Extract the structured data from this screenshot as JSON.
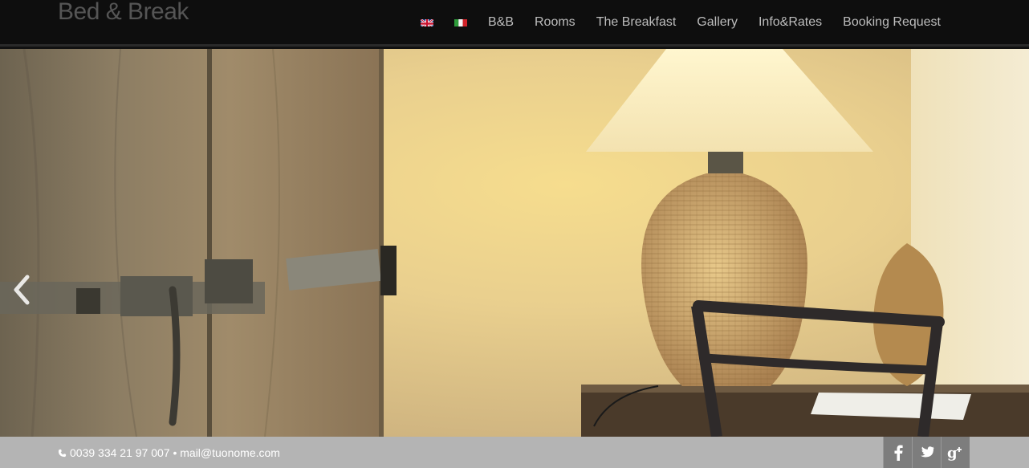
{
  "header": {
    "logo": "Bed & Break",
    "languages": [
      {
        "name": "uk-flag-icon"
      },
      {
        "name": "italy-flag-icon"
      }
    ],
    "nav": [
      "B&B",
      "Rooms",
      "The Breakfast",
      "Gallery",
      "Info&Rates",
      "Booking Request"
    ]
  },
  "hero": {
    "icons": {
      "prev": "chevron-left-icon"
    }
  },
  "footer": {
    "contact": "0039 334 21 97 007 • mail@tuonome.com",
    "social": [
      "facebook-icon",
      "twitter-icon",
      "google-plus-icon"
    ]
  },
  "colors": {
    "topbar": "#0e0e0e",
    "footer": "#b4b4b4",
    "social_bg": "#7d7d7d",
    "nav_text": "#bdbdbd"
  }
}
